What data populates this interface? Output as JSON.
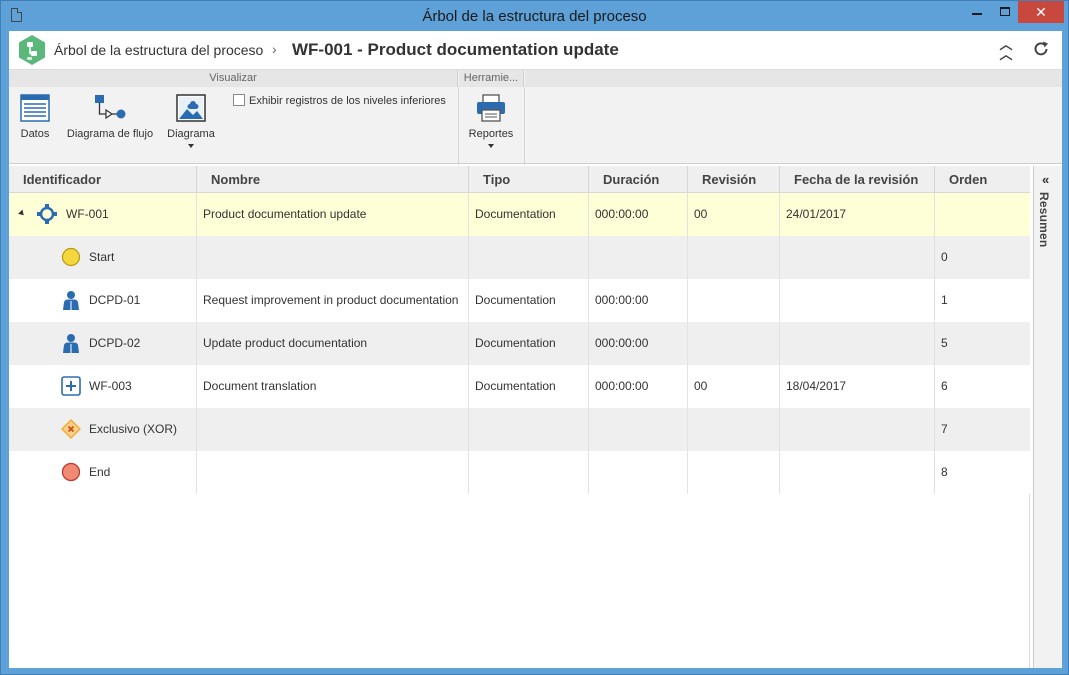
{
  "window": {
    "title": "Árbol de la estructura del proceso"
  },
  "header": {
    "breadcrumb": "Árbol de la estructura del proceso",
    "separator": "›",
    "page_title": "WF-001 - Product documentation update",
    "collapse_icon": "double-chevron-up-icon",
    "refresh_icon": "refresh-icon"
  },
  "ribbon": {
    "groups": [
      {
        "label": "Visualizar"
      },
      {
        "label": "Herramie..."
      }
    ],
    "buttons": {
      "datos": "Datos",
      "diagrama_flujo": "Diagrama de flujo",
      "diagrama": "Diagrama",
      "reportes": "Reportes"
    },
    "checkbox_label": "Exhibir registros de los niveles inferiores",
    "checkbox_checked": false
  },
  "grid": {
    "columns": [
      "Identificador",
      "Nombre",
      "Tipo",
      "Duración",
      "Revisión",
      "Fecha de la revisión",
      "Orden"
    ],
    "rows": [
      {
        "id": "WF-001",
        "icon": "process-icon",
        "nombre": "Product documentation update",
        "tipo": "Documentation",
        "duracion": "000:00:00",
        "revision": "00",
        "fecha": "24/01/2017",
        "orden": "",
        "expanded": true
      },
      {
        "id": "Start",
        "icon": "start-event-icon",
        "nombre": "",
        "tipo": "",
        "duracion": "",
        "revision": "",
        "fecha": "",
        "orden": "0"
      },
      {
        "id": "DCPD-01",
        "icon": "activity-user-icon",
        "nombre": "Request improvement in product documentation",
        "tipo": "Documentation",
        "duracion": "000:00:00",
        "revision": "",
        "fecha": "",
        "orden": "1"
      },
      {
        "id": "DCPD-02",
        "icon": "activity-user-icon",
        "nombre": "Update product documentation",
        "tipo": "Documentation",
        "duracion": "000:00:00",
        "revision": "",
        "fecha": "",
        "orden": "5"
      },
      {
        "id": "WF-003",
        "icon": "subprocess-icon",
        "nombre": "Document translation",
        "tipo": "Documentation",
        "duracion": "000:00:00",
        "revision": "00",
        "fecha": "18/04/2017",
        "orden": "6"
      },
      {
        "id": "Exclusivo (XOR)",
        "icon": "xor-gateway-icon",
        "nombre": "",
        "tipo": "",
        "duracion": "",
        "revision": "",
        "fecha": "",
        "orden": "7"
      },
      {
        "id": "End",
        "icon": "end-event-icon",
        "nombre": "",
        "tipo": "",
        "duracion": "",
        "revision": "",
        "fecha": "",
        "orden": "8"
      }
    ]
  },
  "side_panel": {
    "label": "Resumen",
    "chevron": "«"
  },
  "colors": {
    "window_frame": "#5ea1d8",
    "selected_row": "#ffffd7",
    "alt_row": "#efefef",
    "icon_blue": "#2b6cb0",
    "start_event": "#f5d63d",
    "end_event": "#f08a74",
    "xor_gateway": "#f5a623"
  }
}
